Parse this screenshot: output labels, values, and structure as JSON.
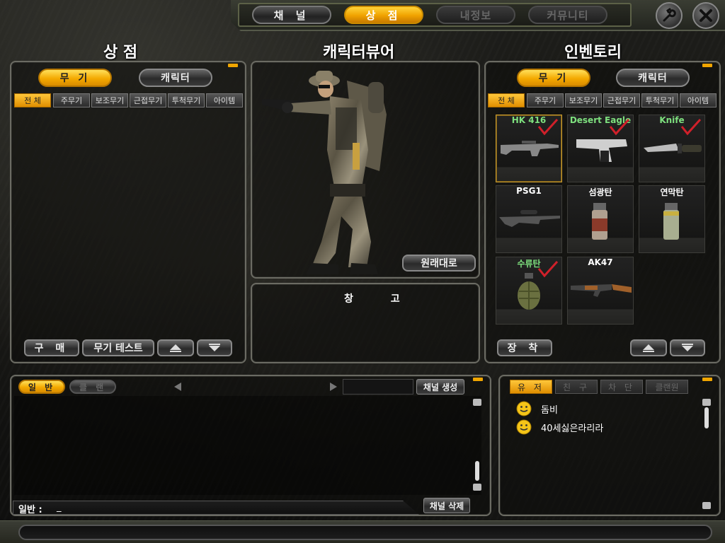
{
  "nav": {
    "tabs": [
      {
        "label": "채 널",
        "state": "normal"
      },
      {
        "label": "상 점",
        "state": "active"
      },
      {
        "label": "내정보",
        "state": "disabled"
      },
      {
        "label": "커뮤니티",
        "state": "disabled"
      }
    ],
    "settings_icon": "wrench-icon",
    "close_icon": "close-icon"
  },
  "titles": {
    "shop": "상 점",
    "viewer": "캐릭터뷰어",
    "inventory": "인벤토리"
  },
  "shop": {
    "main_tabs": [
      "무 기",
      "캐릭터"
    ],
    "sub_tabs": [
      "전 체",
      "주무기",
      "보조무기",
      "근접무기",
      "투척무기",
      "아이템"
    ],
    "buttons": {
      "buy": "구 매",
      "weapon_test": "무기 테스트"
    }
  },
  "viewer": {
    "reset_button": "원래대로",
    "warehouse_label": "창 고"
  },
  "inventory": {
    "main_tabs": [
      "무 기",
      "캐릭터"
    ],
    "sub_tabs": [
      "전 체",
      "주무기",
      "보조무기",
      "근접무기",
      "투척무기",
      "아이템"
    ],
    "items": [
      {
        "name": "HK 416",
        "equipped": true,
        "icon": "rifle-icon"
      },
      {
        "name": "Desert Eagle",
        "equipped": true,
        "icon": "pistol-icon"
      },
      {
        "name": "Knife",
        "equipped": true,
        "icon": "knife-icon"
      },
      {
        "name": "PSG1",
        "equipped": false,
        "icon": "sniper-rifle-icon"
      },
      {
        "name": "섬광탄",
        "equipped": false,
        "icon": "flashbang-icon"
      },
      {
        "name": "연막탄",
        "equipped": false,
        "icon": "smoke-grenade-icon"
      },
      {
        "name": "수류탄",
        "equipped": true,
        "icon": "frag-grenade-icon"
      },
      {
        "name": "AK47",
        "equipped": false,
        "icon": "ak47-icon"
      }
    ],
    "equip_button": "장 착"
  },
  "chat": {
    "tabs": [
      "일 반",
      "클 랜"
    ],
    "create_channel": "채널 생성",
    "delete_channel": "채널 삭제",
    "input_prefix": "일반 :",
    "input_value": "_"
  },
  "users": {
    "tabs": [
      "유 저",
      "친 구",
      "차 단",
      "클랜원"
    ],
    "list": [
      {
        "name": "돔비"
      },
      {
        "name": "40세싫은라리라"
      }
    ]
  },
  "colors": {
    "accent": "#f0a500",
    "equipped_name": "#7ee07e",
    "check": "#d0202a"
  }
}
